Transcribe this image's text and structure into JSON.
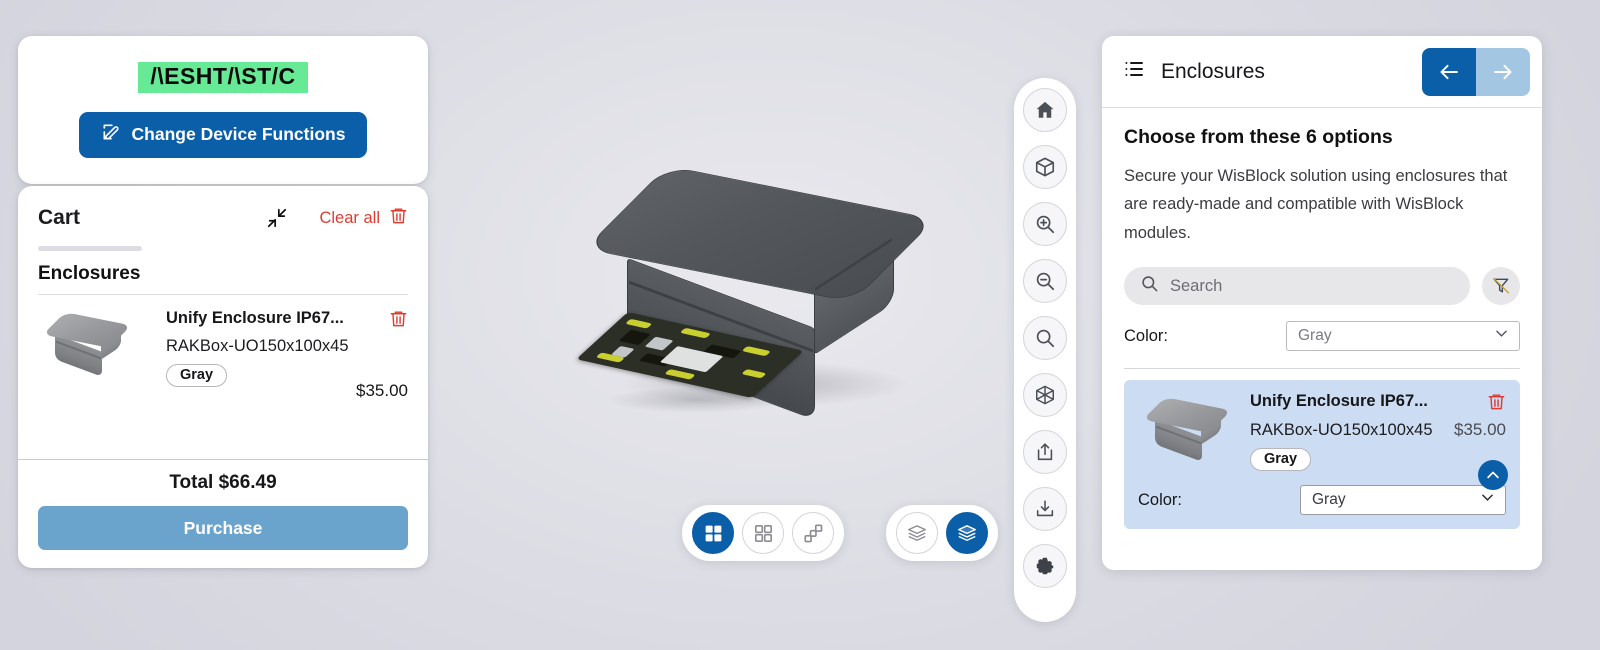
{
  "brand": {
    "logo_text": "/\\ESHT/\\ST/C",
    "logo_bg": "#67ea95",
    "accent_blue": "#0b5ea8",
    "danger_red": "#e03b2f"
  },
  "change_device_functions": {
    "label": "Change Device Functions",
    "icon": "pencil-square-icon"
  },
  "cart": {
    "title": "Cart",
    "collapse_icon": "collapse-arrows-icon",
    "clear_all_label": "Clear all",
    "clear_all_icon": "trash-icon",
    "section_title": "Enclosures",
    "items": [
      {
        "name": "Unify Enclosure IP67...",
        "sku": "RAKBox-UO150x100x45",
        "color_chip": "Gray",
        "price": "$35.00",
        "delete_icon": "trash-icon"
      }
    ],
    "total_label": "Total $66.49",
    "purchase_label": "Purchase"
  },
  "toolbar": {
    "buttons": [
      {
        "name": "home-icon",
        "title": "Home"
      },
      {
        "name": "box-icon",
        "title": "Model"
      },
      {
        "name": "zoom-in-icon",
        "title": "Zoom in"
      },
      {
        "name": "zoom-out-icon",
        "title": "Zoom out"
      },
      {
        "name": "search-icon",
        "title": "Search"
      },
      {
        "name": "wireframe-cube-icon",
        "title": "Wireframe"
      },
      {
        "name": "upload-icon",
        "title": "Share"
      },
      {
        "name": "download-icon",
        "title": "Download"
      },
      {
        "name": "gear-icon",
        "title": "Settings"
      }
    ]
  },
  "view_controls": {
    "layout_group": [
      {
        "name": "grid-filled-icon",
        "active": true
      },
      {
        "name": "grid-outline-icon",
        "active": false
      },
      {
        "name": "scatter-layout-icon",
        "active": false
      }
    ],
    "stack_group": [
      {
        "name": "layers-outline-icon",
        "active": false
      },
      {
        "name": "layers-filled-icon",
        "active": true
      }
    ]
  },
  "right_panel": {
    "list_icon": "list-icon",
    "title": "Enclosures",
    "prev_icon": "arrow-left-icon",
    "next_icon": "arrow-right-icon",
    "heading": "Choose from these 6 options",
    "description": "Secure your WisBlock solution using enclosures that are ready-made and compatible with WisBlock modules.",
    "search": {
      "placeholder": "Search",
      "value": "",
      "icon": "search-icon"
    },
    "filter_icon": "filter-off-icon",
    "color_filter": {
      "label": "Color:",
      "value": "Gray"
    },
    "product": {
      "name": "Unify Enclosure IP67...",
      "sku": "RAKBox-UO150x100x45",
      "price": "$35.00",
      "color_chip": "Gray",
      "delete_icon": "trash-icon",
      "collapse_icon": "chevron-up-icon",
      "color_label": "Color:",
      "color_value": "Gray"
    }
  }
}
